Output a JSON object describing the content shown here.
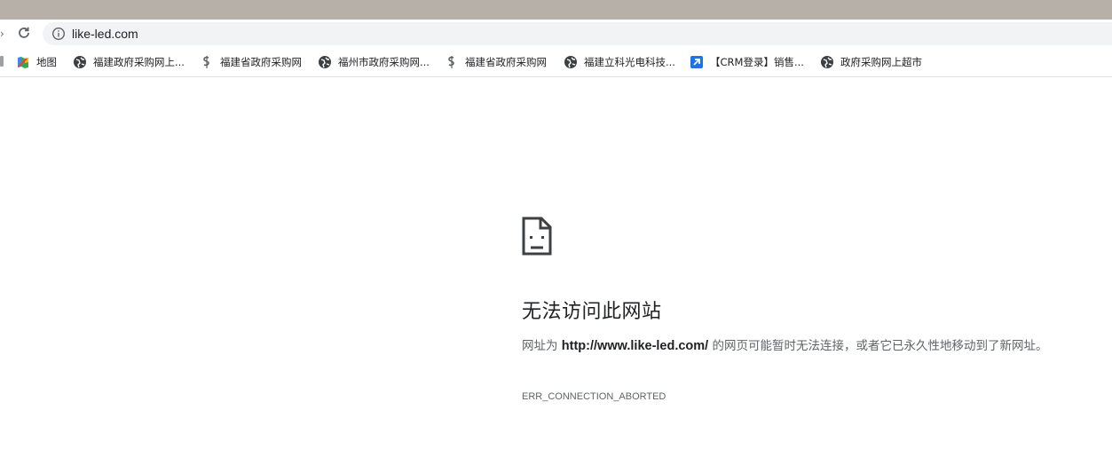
{
  "browser": {
    "url": "like-led.com",
    "bookmarks": [
      {
        "label": "地图",
        "icon": "maps-icon"
      },
      {
        "label": "福建政府采购网上...",
        "icon": "globe-icon"
      },
      {
        "label": "福建省政府采购网",
        "icon": "dollar-icon"
      },
      {
        "label": "福州市政府采购网...",
        "icon": "globe-icon"
      },
      {
        "label": "福建省政府采购网",
        "icon": "dollar-icon"
      },
      {
        "label": "福建立科光电科技...",
        "icon": "globe-icon"
      },
      {
        "label": "【CRM登录】销售...",
        "icon": "arrow-app-icon"
      },
      {
        "label": "政府采购网上超市",
        "icon": "globe-icon"
      }
    ]
  },
  "error": {
    "title": "无法访问此网站",
    "desc_prefix": "网址为 ",
    "desc_url": "http://www.like-led.com/",
    "desc_suffix": " 的网页可能暂时无法连接，或者它已永久性地移动到了新网址。",
    "code": "ERR_CONNECTION_ABORTED",
    "icon": "sad-page-icon"
  },
  "colors": {
    "top_strip": "#b6b0a9",
    "omnibox": "#f1f3f4",
    "text_primary": "#202124",
    "text_secondary": "#5f6368"
  }
}
